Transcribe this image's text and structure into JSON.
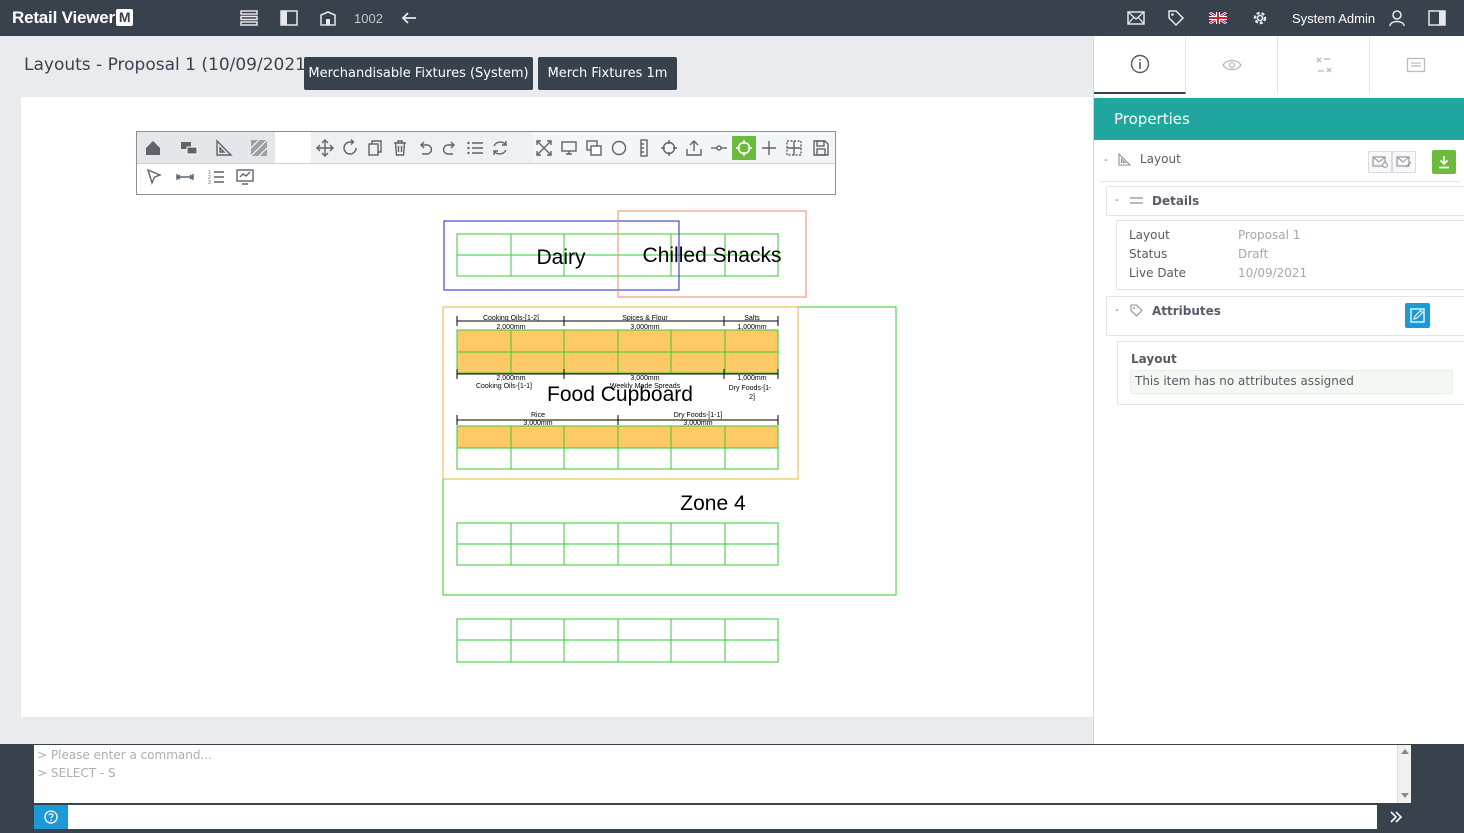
{
  "app": {
    "logo_text": "Retail Viewer",
    "logo_mark": "M",
    "store_number": "1002",
    "user_name": "System Admin"
  },
  "colors": {
    "topbar": "#38424d",
    "accent": "#1fa79f",
    "help": "#1a9ad6",
    "download": "#6cbb3c",
    "edit": "#1a9ad6",
    "shelf_fill": "#ffc966",
    "fixture_outline": "#33cc33",
    "dairy_outline": "#2222cc",
    "snacks_outline": "#ee8866",
    "food_cupboard_outline": "#f0b43c"
  },
  "header": {
    "title": "Layouts - Proposal 1 (10/09/2021)",
    "buttons": [
      "Merchandisable Fixtures (System)",
      "Merch Fixtures 1m"
    ]
  },
  "toolbar_icons": [
    "home-icon",
    "bubbles-icon",
    "set-square-icon",
    "hatch-icon",
    "move-icon",
    "rotate-icon",
    "copy-icon",
    "delete-icon",
    "undo-icon",
    "redo-icon",
    "list-icon",
    "refresh-icon",
    "fit-icon",
    "monitor-icon",
    "layers-icon",
    "circle-icon",
    "ruler-icon",
    "target-icon",
    "upload-icon",
    "link-icon",
    "snap-icon",
    "add-icon",
    "grid-icon",
    "save-icon",
    "pointer-icon",
    "measure-icon",
    "numbered-list-icon",
    "screen-icon"
  ],
  "drawing": {
    "zones": [
      "Dairy",
      "Chilled Snacks",
      "Food Cupboard",
      "Zone 4"
    ],
    "top_labels": [
      "Cooking Oils-[1-2]",
      "Spices & Flour",
      "Salts"
    ],
    "top_dims": [
      "2,000mm",
      "3,000mm",
      "1,000mm"
    ],
    "mid_dims": [
      "2,000mm",
      "3,000mm",
      "1,000mm"
    ],
    "mid_labels": [
      "Cooking Oils-[1-1]",
      "Weekly Made Spreads",
      "Dry Foods-[1-",
      "2]"
    ],
    "low_labels": [
      "Rice",
      "Dry Foods-[1-1]"
    ],
    "low_dims": [
      "3,000mm",
      "3,000mm"
    ]
  },
  "panel": {
    "heading": "Properties",
    "layout_label": "Layout",
    "details_label": "Details",
    "details": [
      {
        "key": "Layout",
        "value": "Proposal 1"
      },
      {
        "key": "Status",
        "value": "Draft"
      },
      {
        "key": "Live Date",
        "value": "10/09/2021"
      }
    ],
    "attributes_label": "Attributes",
    "attr_group": "Layout",
    "attr_empty": "This item has no attributes assigned"
  },
  "console": {
    "lines": [
      "> Please enter a command...",
      "> SELECT - S"
    ]
  }
}
